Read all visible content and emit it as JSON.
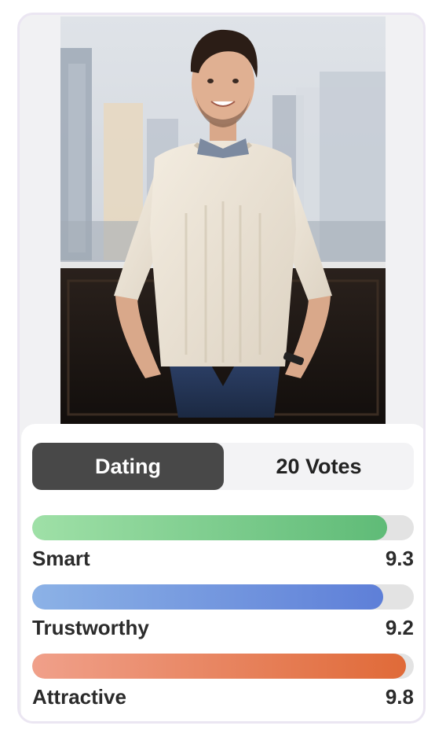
{
  "profile": {
    "photo_alt": "Smiling man in cream cable-knit sweater leaning on a railing with city buildings behind"
  },
  "tabs": {
    "mode_label": "Dating",
    "votes_label": "20 Votes"
  },
  "metrics": [
    {
      "label": "Smart",
      "value": "9.3",
      "fraction": 0.93,
      "color": "#5fbb77"
    },
    {
      "label": "Trustworthy",
      "value": "9.2",
      "fraction": 0.92,
      "color": "#5e7fd8"
    },
    {
      "label": "Attractive",
      "value": "9.8",
      "fraction": 0.98,
      "color": "#e06a38"
    }
  ]
}
